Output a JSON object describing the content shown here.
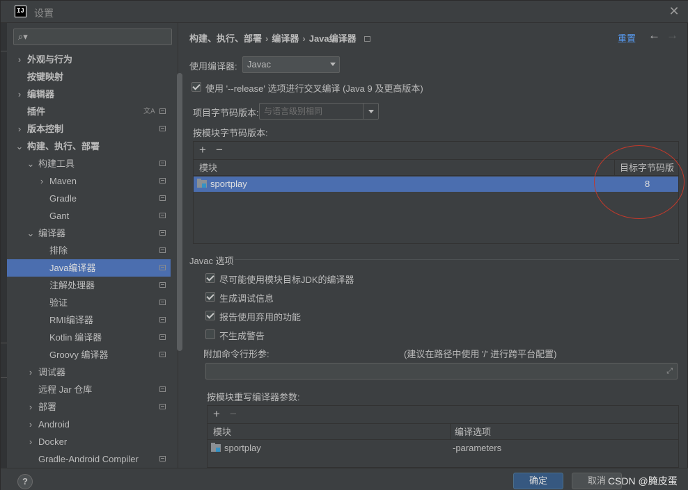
{
  "window": {
    "logo": "IJ",
    "title": "设置"
  },
  "sidebar": {
    "search_placeholder": "",
    "items": [
      {
        "label": "外观与行为",
        "bold": true,
        "indent": 0,
        "arrow": "›"
      },
      {
        "label": "按键映射",
        "bold": true,
        "indent": 0,
        "arrow": ""
      },
      {
        "label": "编辑器",
        "bold": true,
        "indent": 0,
        "arrow": "›"
      },
      {
        "label": "插件",
        "bold": true,
        "indent": 0,
        "arrow": ""
      },
      {
        "label": "版本控制",
        "bold": true,
        "indent": 0,
        "arrow": "›"
      },
      {
        "label": "构建、执行、部署",
        "bold": true,
        "indent": 0,
        "arrow": "⌄"
      },
      {
        "label": "构建工具",
        "indent": 1,
        "arrow": "⌄"
      },
      {
        "label": "Maven",
        "indent": 2,
        "arrow": "›"
      },
      {
        "label": "Gradle",
        "indent": 2,
        "arrow": ""
      },
      {
        "label": "Gant",
        "indent": 2,
        "arrow": ""
      },
      {
        "label": "编译器",
        "indent": 1,
        "arrow": "⌄"
      },
      {
        "label": "排除",
        "indent": 2,
        "arrow": ""
      },
      {
        "label": "Java编译器",
        "indent": 2,
        "arrow": "",
        "selected": true
      },
      {
        "label": "注解处理器",
        "indent": 2,
        "arrow": ""
      },
      {
        "label": "验证",
        "indent": 2,
        "arrow": ""
      },
      {
        "label": "RMI编译器",
        "indent": 2,
        "arrow": ""
      },
      {
        "label": "Kotlin 编译器",
        "indent": 2,
        "arrow": ""
      },
      {
        "label": "Groovy 编译器",
        "indent": 2,
        "arrow": ""
      },
      {
        "label": "调试器",
        "indent": 1,
        "arrow": "›"
      },
      {
        "label": "远程 Jar 仓库",
        "indent": 1,
        "arrow": ""
      },
      {
        "label": "部署",
        "indent": 1,
        "arrow": "›"
      },
      {
        "label": "Android",
        "indent": 1,
        "arrow": "›"
      },
      {
        "label": "Docker",
        "indent": 1,
        "arrow": "›"
      },
      {
        "label": "Gradle-Android Compiler",
        "indent": 1,
        "arrow": ""
      }
    ]
  },
  "header": {
    "breadcrumb": [
      "构建、执行、部署",
      "编译器",
      "Java编译器"
    ],
    "reset": "重置"
  },
  "compiler": {
    "use_label": "使用编译器:",
    "use_value": "Javac",
    "release_option": "使用 '--release' 选项进行交叉编译 (Java 9 及更高版本)",
    "project_bytecode_label": "项目字节码版本:",
    "project_bytecode_placeholder": "与语言级别相同",
    "per_module_label": "按模块字节码版本:",
    "module_table": {
      "col_module": "模块",
      "col_target": "目标字节码版本",
      "rows": [
        {
          "module": "sportplay",
          "target": "8"
        }
      ]
    }
  },
  "javac": {
    "section": "Javac 选项",
    "options": [
      {
        "label": "尽可能使用模块目标JDK的编译器",
        "checked": true
      },
      {
        "label": "生成调试信息",
        "checked": true
      },
      {
        "label": "报告使用弃用的功能",
        "checked": true
      },
      {
        "label": "不生成警告",
        "checked": false
      }
    ],
    "extra_label": "附加命令行形参:",
    "extra_hint": "(建议在路径中使用 '/' 进行跨平台配置)",
    "override_label": "按模块重写编译器参数:",
    "override_table": {
      "col_module": "模块",
      "col_options": "编译选项",
      "rows": [
        {
          "module": "sportplay",
          "options": "-parameters"
        }
      ]
    }
  },
  "footer": {
    "help": "?",
    "ok": "确定",
    "cancel": "取消",
    "watermark": "CSDN @腌皮蛋"
  }
}
